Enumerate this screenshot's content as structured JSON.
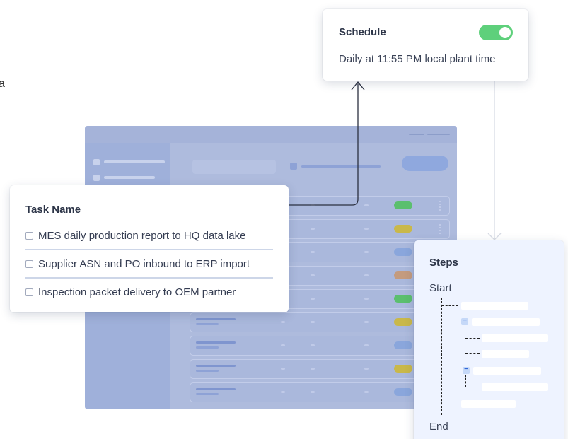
{
  "edge_fragment": "a",
  "schedule_card": {
    "title": "Schedule",
    "toggle_enabled": true,
    "description": "Daily at 11:55 PM local plant time"
  },
  "task_card": {
    "title": "Task Name",
    "tasks": [
      {
        "label": "MES daily production report to HQ data lake"
      },
      {
        "label": "Supplier ASN and PO inbound to ERP import"
      },
      {
        "label": "Inspection packet delivery to OEM partner"
      }
    ]
  },
  "steps_card": {
    "title": "Steps",
    "start_label": "Start",
    "end_label": "End"
  },
  "dashboard": {
    "row_status_colors": [
      "#5bbf6e",
      "#c9b84a",
      "#8aa6dc",
      "#c49b7e",
      "#5bbf6e",
      "#c9b84a",
      "#8aa6dc",
      "#c9b84a",
      "#8aa6dc"
    ]
  },
  "colors": {
    "toggle_on": "#5ed07b",
    "dashboard_bg": "#aebbdd",
    "steps_bg": "#eef3ff"
  }
}
